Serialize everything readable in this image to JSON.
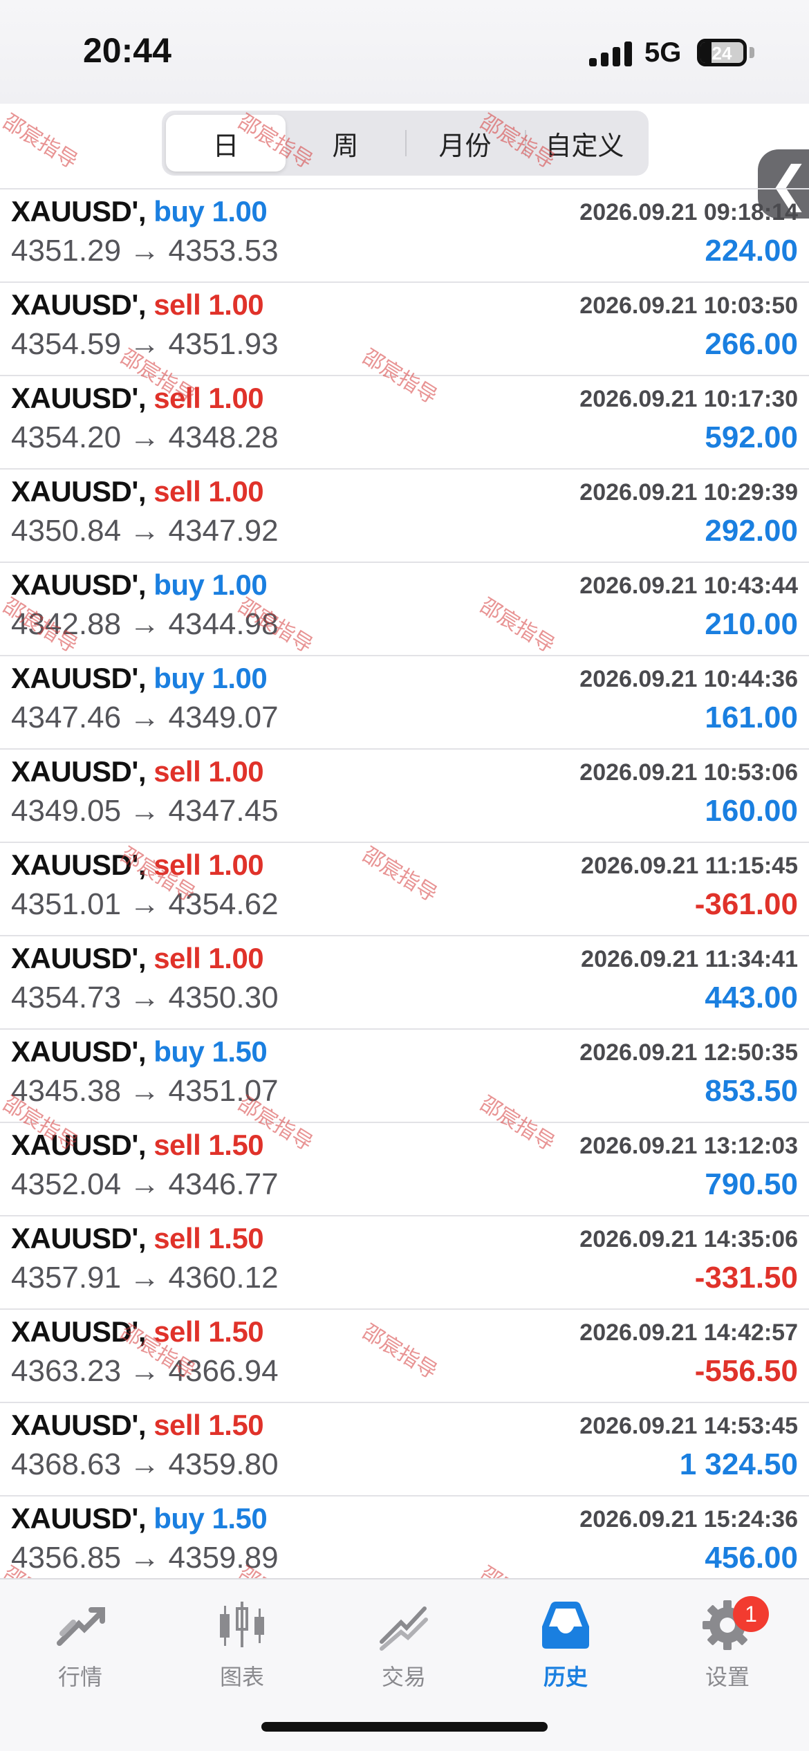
{
  "status_bar": {
    "time": "20:44",
    "network": "5G",
    "battery": "24"
  },
  "tabs": [
    "日",
    "周",
    "月份",
    "自定义"
  ],
  "back_icon": "chevron-left",
  "watermark": "邵宸指导",
  "colors": {
    "buy": "#1a7fe0",
    "sell": "#e0322a",
    "profit_positive": "#1a7fe0",
    "profit_negative": "#e0322a",
    "active_tab": "#1a7fe0"
  },
  "orders": [
    {
      "symbol": "XAUUSD',",
      "side": "buy",
      "volume": "1.00",
      "time": "2026.09.21 09:18:14",
      "prices": "4351.29 → 4353.53",
      "profit": "224.00"
    },
    {
      "symbol": "XAUUSD',",
      "side": "sell",
      "volume": "1.00",
      "time": "2026.09.21 10:03:50",
      "prices": "4354.59 → 4351.93",
      "profit": "266.00"
    },
    {
      "symbol": "XAUUSD',",
      "side": "sell",
      "volume": "1.00",
      "time": "2026.09.21 10:17:30",
      "prices": "4354.20 → 4348.28",
      "profit": "592.00"
    },
    {
      "symbol": "XAUUSD',",
      "side": "sell",
      "volume": "1.00",
      "time": "2026.09.21 10:29:39",
      "prices": "4350.84 → 4347.92",
      "profit": "292.00"
    },
    {
      "symbol": "XAUUSD',",
      "side": "buy",
      "volume": "1.00",
      "time": "2026.09.21 10:43:44",
      "prices": "4342.88 → 4344.98",
      "profit": "210.00"
    },
    {
      "symbol": "XAUUSD',",
      "side": "buy",
      "volume": "1.00",
      "time": "2026.09.21 10:44:36",
      "prices": "4347.46 → 4349.07",
      "profit": "161.00"
    },
    {
      "symbol": "XAUUSD',",
      "side": "sell",
      "volume": "1.00",
      "time": "2026.09.21 10:53:06",
      "prices": "4349.05 → 4347.45",
      "profit": "160.00"
    },
    {
      "symbol": "XAUUSD',",
      "side": "sell",
      "volume": "1.00",
      "time": "2026.09.21 11:15:45",
      "prices": "4351.01 → 4354.62",
      "profit": "-361.00"
    },
    {
      "symbol": "XAUUSD',",
      "side": "sell",
      "volume": "1.00",
      "time": "2026.09.21 11:34:41",
      "prices": "4354.73 → 4350.30",
      "profit": "443.00"
    },
    {
      "symbol": "XAUUSD',",
      "side": "buy",
      "volume": "1.50",
      "time": "2026.09.21 12:50:35",
      "prices": "4345.38 → 4351.07",
      "profit": "853.50"
    },
    {
      "symbol": "XAUUSD',",
      "side": "sell",
      "volume": "1.50",
      "time": "2026.09.21 13:12:03",
      "prices": "4352.04 → 4346.77",
      "profit": "790.50"
    },
    {
      "symbol": "XAUUSD',",
      "side": "sell",
      "volume": "1.50",
      "time": "2026.09.21 14:35:06",
      "prices": "4357.91 → 4360.12",
      "profit": "-331.50"
    },
    {
      "symbol": "XAUUSD',",
      "side": "sell",
      "volume": "1.50",
      "time": "2026.09.21 14:42:57",
      "prices": "4363.23 → 4366.94",
      "profit": "-556.50"
    },
    {
      "symbol": "XAUUSD',",
      "side": "sell",
      "volume": "1.50",
      "time": "2026.09.21 14:53:45",
      "prices": "4368.63 → 4359.80",
      "profit": "1 324.50"
    },
    {
      "symbol": "XAUUSD',",
      "side": "buy",
      "volume": "1.50",
      "time": "2026.09.21 15:24:36",
      "prices": "4356.85 → 4359.89",
      "profit": "456.00"
    }
  ],
  "bottom_nav": [
    {
      "label": "行情",
      "icon": "quotes-icon"
    },
    {
      "label": "图表",
      "icon": "candlestick-icon"
    },
    {
      "label": "交易",
      "icon": "trade-icon"
    },
    {
      "label": "历史",
      "icon": "history-icon",
      "active": true
    },
    {
      "label": "设置",
      "icon": "gear-icon",
      "badge": "1"
    }
  ]
}
